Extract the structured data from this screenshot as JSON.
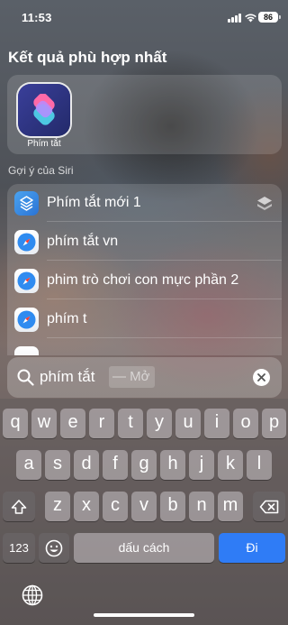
{
  "status_bar": {
    "time": "11:53",
    "battery": "86"
  },
  "top_hit": {
    "section_title": "Kết quả phù hợp nhất",
    "app_name": "Phím tắt",
    "icon": "shortcuts-app-icon"
  },
  "siri_suggestions": {
    "title": "Gợi ý của Siri",
    "items": [
      {
        "label": "Phím tắt mới 1",
        "icon": "shortcut-icon"
      },
      {
        "label": "phím tắt vn",
        "icon": "safari-icon"
      },
      {
        "label": "phim trò chơi con mực phần 2",
        "icon": "safari-icon"
      },
      {
        "label": "phím t",
        "icon": "safari-icon"
      }
    ]
  },
  "search": {
    "query": "phím tắt",
    "suffix": "— Mở"
  },
  "keyboard": {
    "row1": [
      "q",
      "w",
      "e",
      "r",
      "t",
      "y",
      "u",
      "i",
      "o",
      "p"
    ],
    "row2": [
      "a",
      "s",
      "d",
      "f",
      "g",
      "h",
      "j",
      "k",
      "l"
    ],
    "row3": [
      "z",
      "x",
      "c",
      "v",
      "b",
      "n",
      "m"
    ],
    "numbers_key": "123",
    "space_label": "dấu cách",
    "go_label": "Đi"
  },
  "colors": {
    "go_key": "#2f7cf6",
    "shortcut_icon": "#2b73d4"
  }
}
